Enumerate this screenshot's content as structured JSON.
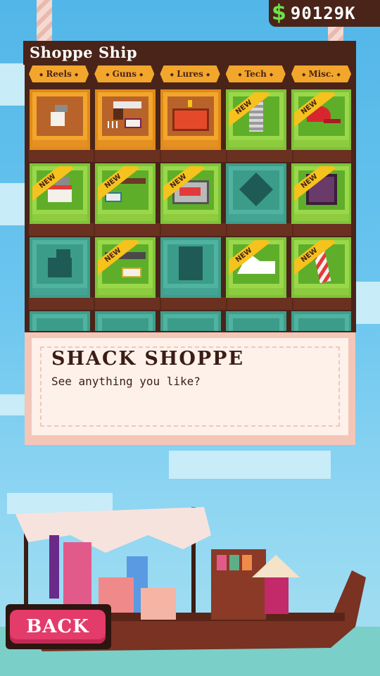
{
  "hud": {
    "currency_symbol": "$",
    "money": "90129K"
  },
  "shop": {
    "title": "Shoppe Ship",
    "tabs": [
      "Reels",
      "Guns",
      "Lures",
      "Tech",
      "Misc."
    ],
    "new_badge": "NEW",
    "rows": [
      [
        {
          "icon": "fishing-reel-icon",
          "state": "owned"
        },
        {
          "icon": "revolver-icon",
          "state": "owned"
        },
        {
          "icon": "dynamite-crate-icon",
          "state": "owned"
        },
        {
          "icon": "spring-icon",
          "state": "new"
        },
        {
          "icon": "red-cap-icon",
          "state": "new"
        }
      ],
      [
        {
          "icon": "fishing-reel-icon",
          "state": "new"
        },
        {
          "icon": "shotgun-icon",
          "state": "new"
        },
        {
          "icon": "gadget-box-icon",
          "state": "new"
        },
        {
          "icon": "spider-lure-icon",
          "state": "locked"
        },
        {
          "icon": "safe-box-icon",
          "state": "new"
        }
      ],
      [
        {
          "icon": "fishing-reel-icon",
          "state": "locked"
        },
        {
          "icon": "machine-gun-icon",
          "state": "new"
        },
        {
          "icon": "fuel-can-icon",
          "state": "locked"
        },
        {
          "icon": "paper-boat-icon",
          "state": "new"
        },
        {
          "icon": "striped-sock-icon",
          "state": "new"
        }
      ]
    ]
  },
  "dialog": {
    "speaker": "SHACK SHOPPE",
    "text": "See anything you like?"
  },
  "back_button": {
    "label": "BACK"
  },
  "colors": {
    "panel": "#4a2418",
    "tab": "#f3a62c",
    "owned": "#f3a62c",
    "new": "#9ad84a",
    "locked": "#4fb3a0",
    "back": "#e33b6a"
  }
}
